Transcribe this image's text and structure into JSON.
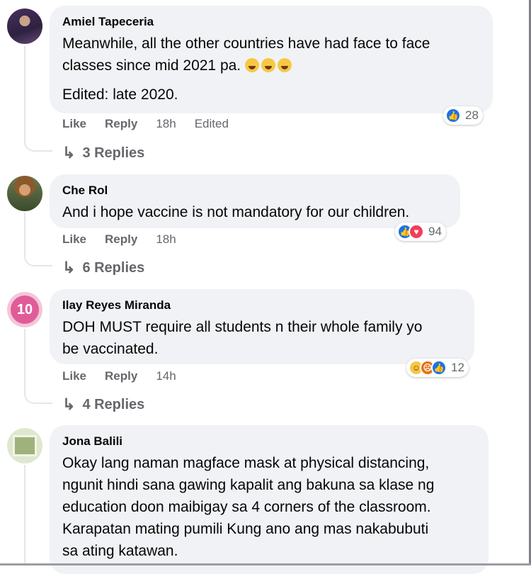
{
  "comments": [
    {
      "author": "Amiel Tapeceria",
      "text_lines": [
        "Meanwhile, all the other countries have had face to face",
        "classes since mid 2021 pa."
      ],
      "edit_note": "Edited: late 2020.",
      "like_label": "Like",
      "reply_label": "Reply",
      "time": "18h",
      "edited_label": "Edited",
      "reaction_count": "28",
      "reactions": [
        "like"
      ],
      "replies_label": "3 Replies"
    },
    {
      "author": "Che Rol",
      "text_lines": [
        "And i hope vaccine is not mandatory for our children."
      ],
      "like_label": "Like",
      "reply_label": "Reply",
      "time": "18h",
      "reaction_count": "94",
      "reactions": [
        "like",
        "love"
      ],
      "replies_label": "6 Replies"
    },
    {
      "author": "Ilay Reyes Miranda",
      "avatar_badge": "10",
      "text_lines": [
        "DOH MUST require all students n their whole family yo",
        "be vaccinated."
      ],
      "like_label": "Like",
      "reply_label": "Reply",
      "time": "14h",
      "reaction_count": "12",
      "reactions": [
        "haha",
        "angry",
        "like"
      ],
      "replies_label": "4 Replies"
    },
    {
      "author": "Jona Balili",
      "text_lines": [
        "Okay lang naman magface mask at physical distancing,",
        "ngunit hindi sana gawing kapalit ang bakuna sa klase ng",
        "education doon maibigay sa 4 corners of the classroom.",
        "Karapatan mating pumili Kung ano ang mas nakabubuti",
        "sa ating katawan."
      ]
    }
  ],
  "colors": {
    "bubble": "#f0f2f5",
    "meta_text": "#65676b",
    "like_blue": "#1b74e4",
    "love_red": "#f33e58",
    "angry_orange": "#e9710f",
    "haha_yellow": "#f7c843"
  },
  "icons": {
    "reply_arrow": "reply-arrow-icon",
    "laugh_emoji": "rolling-laughing-emoji-icon"
  }
}
